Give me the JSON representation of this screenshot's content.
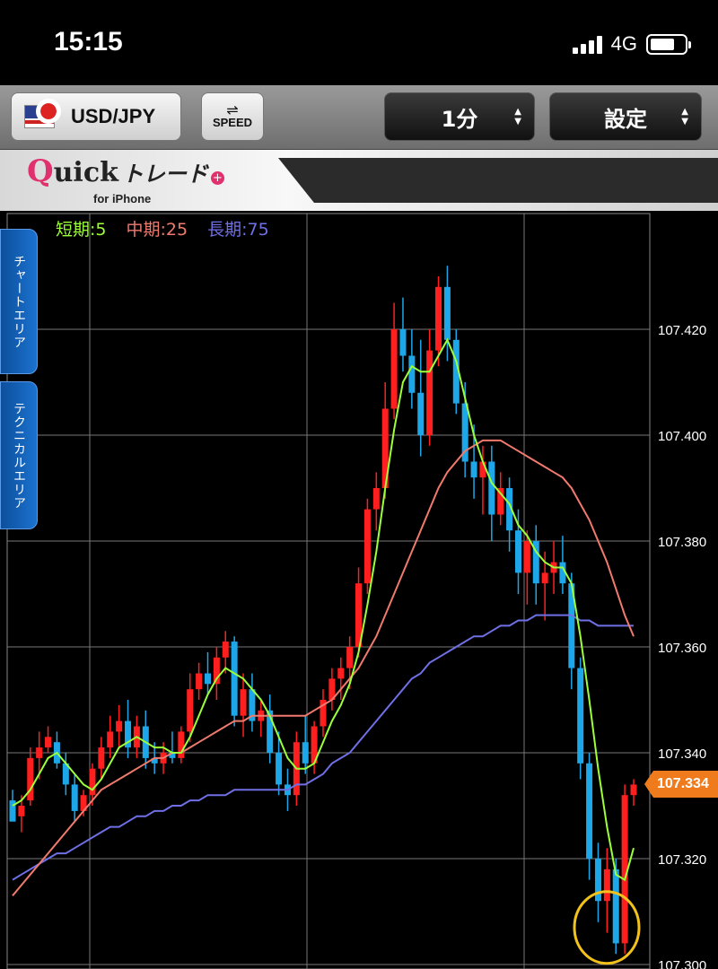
{
  "status_bar": {
    "time": "15:15",
    "network": "4G"
  },
  "toolbar": {
    "pair_label": "USD/JPY",
    "speed_label": "SPEED",
    "period_value": "1分",
    "settings_value": "設定"
  },
  "banner": {
    "logo_q": "Q",
    "logo_uick": "uick",
    "logo_trade": "トレード",
    "logo_plus": "+",
    "sub": "for iPhone"
  },
  "side_tabs": {
    "chart_area": "チャートエリア",
    "technical_area": "テクニカルエリア"
  },
  "colors": {
    "up": "#ff1f1f",
    "down": "#1ea7e8",
    "ma_short": "#9cff3a",
    "ma_mid": "#f07a6e",
    "ma_long": "#6f6fe6",
    "grid": "#ffffff",
    "badge": "#f07b1c",
    "highlight": "#f2c21b"
  },
  "legend": [
    {
      "label": "短期:5",
      "color": "#9cff3a"
    },
    {
      "label": "中期:25",
      "color": "#f07a6e"
    },
    {
      "label": "長期:75",
      "color": "#6f6fe6"
    }
  ],
  "chart_data": {
    "type": "candlestick",
    "ylim": [
      107.3,
      107.44
    ],
    "y_ticks": [
      "107.420",
      "107.400",
      "107.380",
      "107.360",
      "107.340",
      "107.320",
      "107.300"
    ],
    "y_tick_values": [
      107.42,
      107.4,
      107.38,
      107.36,
      107.34,
      107.32,
      107.3
    ],
    "current_price": "107.334",
    "current_price_value": 107.334,
    "candles": [
      [
        107.331,
        107.333,
        107.328,
        107.327
      ],
      [
        107.328,
        107.332,
        107.325,
        107.33
      ],
      [
        107.331,
        107.341,
        107.33,
        107.339
      ],
      [
        107.339,
        107.344,
        107.335,
        107.341
      ],
      [
        107.341,
        107.345,
        107.34,
        107.343
      ],
      [
        107.342,
        107.344,
        107.337,
        107.338
      ],
      [
        107.338,
        107.34,
        107.332,
        107.334
      ],
      [
        107.334,
        107.336,
        107.327,
        107.329
      ],
      [
        107.329,
        107.333,
        107.328,
        107.332
      ],
      [
        107.332,
        107.338,
        107.33,
        107.337
      ],
      [
        107.337,
        107.343,
        107.335,
        107.341
      ],
      [
        107.341,
        107.347,
        107.339,
        107.344
      ],
      [
        107.344,
        107.349,
        107.341,
        107.346
      ],
      [
        107.346,
        107.35,
        107.339,
        107.341
      ],
      [
        107.341,
        107.347,
        107.339,
        107.345
      ],
      [
        107.345,
        107.348,
        107.337,
        107.339
      ],
      [
        107.339,
        107.342,
        107.336,
        107.338
      ],
      [
        107.338,
        107.342,
        107.336,
        107.34
      ],
      [
        107.34,
        107.344,
        107.338,
        107.339
      ],
      [
        107.339,
        107.345,
        107.338,
        107.344
      ],
      [
        107.344,
        107.355,
        107.342,
        107.352
      ],
      [
        107.352,
        107.357,
        107.35,
        107.355
      ],
      [
        107.355,
        107.359,
        107.351,
        107.353
      ],
      [
        107.353,
        107.36,
        107.35,
        107.358
      ],
      [
        107.358,
        107.363,
        107.355,
        107.361
      ],
      [
        107.361,
        107.362,
        107.345,
        107.347
      ],
      [
        107.347,
        107.355,
        107.343,
        107.352
      ],
      [
        107.352,
        107.355,
        107.344,
        107.346
      ],
      [
        107.346,
        107.35,
        107.343,
        107.348
      ],
      [
        107.348,
        107.351,
        107.338,
        107.34
      ],
      [
        107.34,
        107.344,
        107.332,
        107.334
      ],
      [
        107.334,
        107.337,
        107.329,
        107.332
      ],
      [
        107.332,
        107.344,
        107.33,
        107.342
      ],
      [
        107.342,
        107.347,
        107.336,
        107.338
      ],
      [
        107.338,
        107.346,
        107.336,
        107.345
      ],
      [
        107.345,
        107.352,
        107.343,
        107.35
      ],
      [
        107.35,
        107.356,
        107.348,
        107.354
      ],
      [
        107.354,
        107.358,
        107.35,
        107.356
      ],
      [
        107.356,
        107.362,
        107.352,
        107.36
      ],
      [
        107.36,
        107.375,
        107.358,
        107.372
      ],
      [
        107.372,
        107.388,
        107.37,
        107.386
      ],
      [
        107.386,
        107.393,
        107.382,
        107.39
      ],
      [
        107.39,
        107.41,
        107.388,
        107.405
      ],
      [
        107.405,
        107.425,
        107.403,
        107.42
      ],
      [
        107.42,
        107.426,
        107.412,
        107.415
      ],
      [
        107.415,
        107.42,
        107.405,
        107.408
      ],
      [
        107.408,
        107.418,
        107.396,
        107.4
      ],
      [
        107.4,
        107.42,
        107.398,
        107.416
      ],
      [
        107.416,
        107.43,
        107.413,
        107.428
      ],
      [
        107.428,
        107.432,
        107.414,
        107.418
      ],
      [
        107.418,
        107.42,
        107.404,
        107.406
      ],
      [
        107.406,
        107.41,
        107.392,
        107.395
      ],
      [
        107.395,
        107.402,
        107.388,
        107.392
      ],
      [
        107.392,
        107.398,
        107.385,
        107.395
      ],
      [
        107.395,
        107.398,
        107.38,
        107.385
      ],
      [
        107.385,
        107.393,
        107.383,
        107.39
      ],
      [
        107.39,
        107.392,
        107.378,
        107.382
      ],
      [
        107.382,
        107.386,
        107.37,
        107.374
      ],
      [
        107.374,
        107.382,
        107.368,
        107.38
      ],
      [
        107.38,
        107.383,
        107.368,
        107.372
      ],
      [
        107.372,
        107.378,
        107.365,
        107.374
      ],
      [
        107.374,
        107.38,
        107.37,
        107.376
      ],
      [
        107.376,
        107.381,
        107.37,
        107.372
      ],
      [
        107.372,
        107.374,
        107.352,
        107.356
      ],
      [
        107.356,
        107.358,
        107.335,
        107.338
      ],
      [
        107.338,
        107.34,
        107.316,
        107.32
      ],
      [
        107.32,
        107.323,
        107.308,
        107.312
      ],
      [
        107.312,
        107.322,
        107.306,
        107.318
      ],
      [
        107.318,
        107.32,
        107.302,
        107.304
      ],
      [
        107.304,
        107.334,
        107.302,
        107.332
      ],
      [
        107.332,
        107.335,
        107.33,
        107.334
      ]
    ],
    "ma_short": [
      107.33,
      107.331,
      107.333,
      107.336,
      107.339,
      107.34,
      107.338,
      107.336,
      107.334,
      107.333,
      107.335,
      107.338,
      107.341,
      107.342,
      107.343,
      107.342,
      107.341,
      107.341,
      107.34,
      107.34,
      107.343,
      107.347,
      107.351,
      107.354,
      107.356,
      107.355,
      107.354,
      107.352,
      107.35,
      107.347,
      107.343,
      107.339,
      107.337,
      107.337,
      107.338,
      107.342,
      107.346,
      107.349,
      107.353,
      107.359,
      107.368,
      107.378,
      107.39,
      107.401,
      107.41,
      107.413,
      107.412,
      107.412,
      107.415,
      107.418,
      107.414,
      107.407,
      107.4,
      107.395,
      107.391,
      107.389,
      107.387,
      107.383,
      107.381,
      107.378,
      107.376,
      107.375,
      107.375,
      107.372,
      107.362,
      107.35,
      107.337,
      107.326,
      107.317,
      107.316,
      107.322
    ],
    "ma_mid": [
      107.313,
      107.315,
      107.317,
      107.319,
      107.321,
      107.323,
      107.325,
      107.327,
      107.329,
      107.331,
      107.333,
      107.334,
      107.335,
      107.336,
      107.337,
      107.338,
      107.339,
      107.339,
      107.34,
      107.34,
      107.341,
      107.342,
      107.343,
      107.344,
      107.345,
      107.346,
      107.346,
      107.347,
      107.347,
      107.347,
      107.347,
      107.347,
      107.347,
      107.347,
      107.348,
      107.349,
      107.35,
      107.352,
      107.354,
      107.356,
      107.359,
      107.362,
      107.366,
      107.37,
      107.374,
      107.378,
      107.382,
      107.386,
      107.39,
      107.393,
      107.395,
      107.397,
      107.398,
      107.399,
      107.399,
      107.399,
      107.398,
      107.397,
      107.396,
      107.395,
      107.394,
      107.393,
      107.392,
      107.39,
      107.387,
      107.384,
      107.38,
      107.376,
      107.371,
      107.366,
      107.362
    ],
    "ma_long": [
      107.316,
      107.317,
      107.318,
      107.319,
      107.32,
      107.321,
      107.321,
      107.322,
      107.323,
      107.324,
      107.325,
      107.326,
      107.326,
      107.327,
      107.328,
      107.328,
      107.329,
      107.329,
      107.33,
      107.33,
      107.331,
      107.331,
      107.332,
      107.332,
      107.332,
      107.333,
      107.333,
      107.333,
      107.333,
      107.333,
      107.333,
      107.333,
      107.334,
      107.334,
      107.335,
      107.336,
      107.338,
      107.339,
      107.34,
      107.342,
      107.344,
      107.346,
      107.348,
      107.35,
      107.352,
      107.354,
      107.355,
      107.357,
      107.358,
      107.359,
      107.36,
      107.361,
      107.362,
      107.362,
      107.363,
      107.364,
      107.364,
      107.365,
      107.365,
      107.366,
      107.366,
      107.366,
      107.366,
      107.366,
      107.365,
      107.365,
      107.364,
      107.364,
      107.364,
      107.364,
      107.364
    ]
  }
}
